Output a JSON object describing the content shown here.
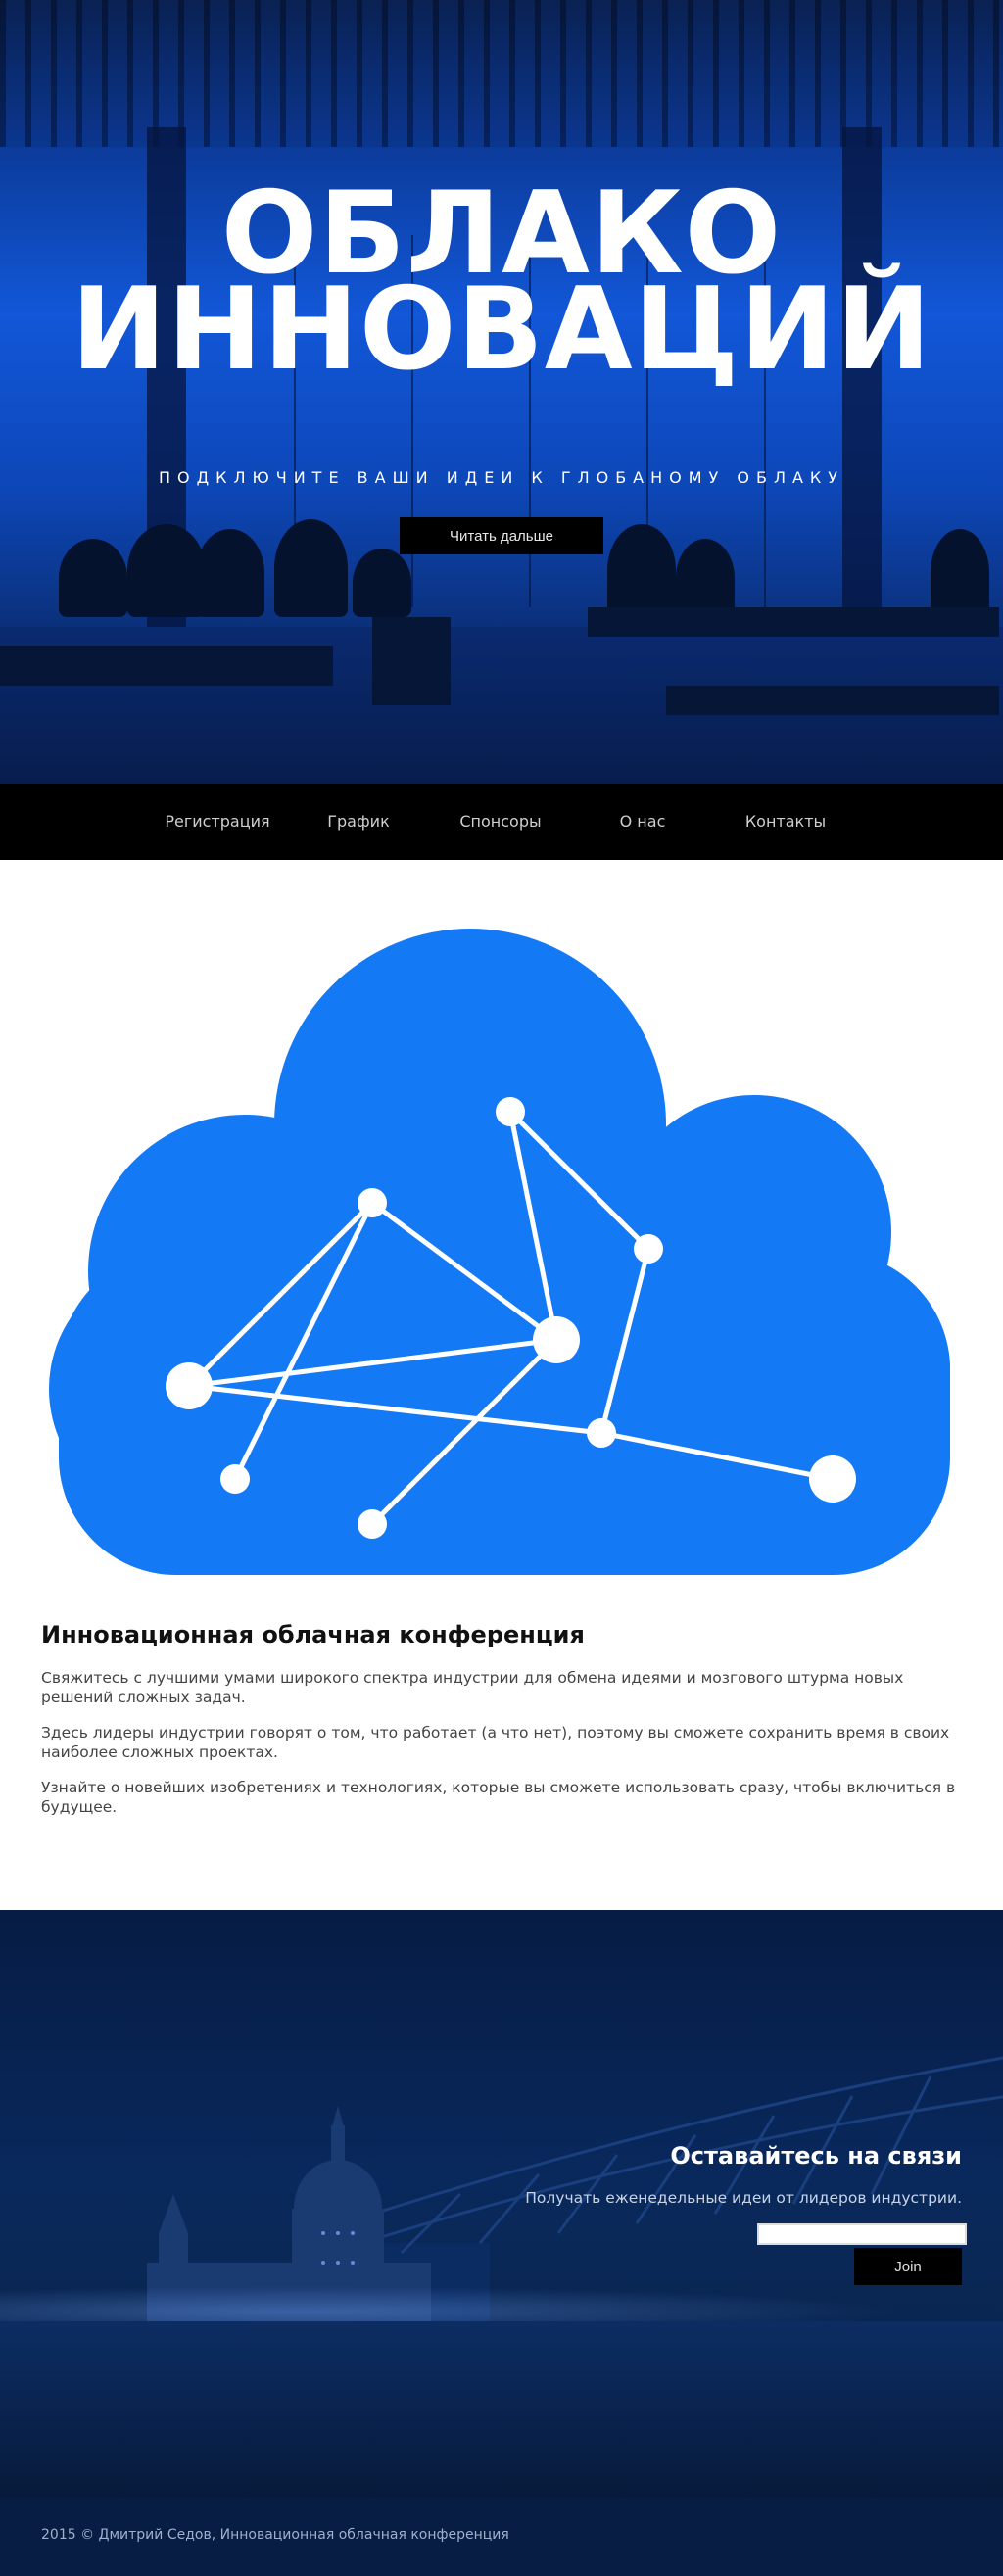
{
  "hero": {
    "title_line1": "ОБЛАКО",
    "title_line2": "ИННОВАЦИЙ",
    "tagline": "ПОДКЛЮЧИТЕ ВАШИ ИДЕИ К ГЛОБАНОМУ ОБЛАКУ",
    "cta_label": "Читать дальше"
  },
  "nav": {
    "items": [
      {
        "label": "Регистрация"
      },
      {
        "label": "График"
      },
      {
        "label": "Спонсоры"
      },
      {
        "label": "О нас"
      },
      {
        "label": "Контакты"
      }
    ]
  },
  "colors": {
    "accent": "#1479f5",
    "nav_bg": "#000000",
    "hero_blue": "#1257d8"
  },
  "content": {
    "title": "Инновационная облачная конференция",
    "paragraphs": [
      "Свяжитесь с лучшими умами широкого спектра индустрии для обмена идеями и мозгового штурма новых решений сложных задач.",
      "Здесь лидеры индустрии говорят о том, что работает (а что нет), поэтому вы сможете сохранить время в своих наиболее сложных проектах.",
      "Узнайте о новейших изобретениях и технологиях, которые вы сможете использовать сразу, чтобы включиться в будущее."
    ]
  },
  "newsletter": {
    "title": "Оставайтесь на связи",
    "subtitle": "Получать еженедельные идеи от лидеров индустрии.",
    "input_value": "",
    "button_label": "Join"
  },
  "footer": {
    "text": "2015 © Дмитрий Седов, Инновационная облачная конференция"
  }
}
